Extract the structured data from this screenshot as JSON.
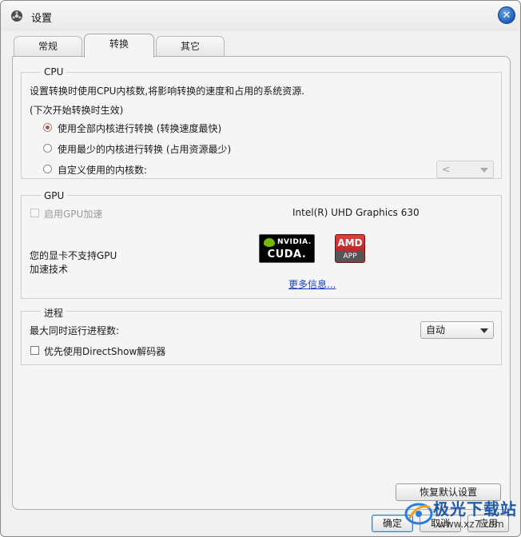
{
  "window": {
    "title": "设置"
  },
  "tabs": [
    {
      "label": "常规"
    },
    {
      "label": "转换"
    },
    {
      "label": "其它"
    }
  ],
  "cpu": {
    "group_label": "CPU",
    "description": "设置转换时使用CPU内核数,将影响转换的速度和占用的系统资源.",
    "note": "(下次开始转换时生效)",
    "options": [
      {
        "label": "使用全部内核进行转换 (转换速度最快)",
        "checked": true
      },
      {
        "label": "使用最少的内核进行转换 (占用资源最少)",
        "checked": false
      },
      {
        "label": "自定义使用的内核数:",
        "checked": false
      }
    ],
    "custom_select_value": "<"
  },
  "gpu": {
    "group_label": "GPU",
    "enable_label": "启用GPU加速",
    "adapter_name": "Intel(R) UHD Graphics 630",
    "unsupported_line1": "您的显卡不支持GPU",
    "unsupported_line2": "加速技术",
    "nvidia_brand": "NVIDIA.",
    "nvidia_product": "CUDA.",
    "amd_brand": "AMD",
    "amd_product": "APP",
    "more_info_link": "更多信息..."
  },
  "process": {
    "group_label": "进程",
    "max_processes_label": "最大同时运行进程数:",
    "max_processes_value": "自动",
    "directshow_label": "优先使用DirectShow解码器"
  },
  "buttons": {
    "restore_defaults": "恢复默认设置",
    "ok": "确定",
    "cancel": "取消",
    "apply": "应用"
  },
  "watermark": {
    "title": "极光下载站",
    "url": "www.xz7.com"
  },
  "colors": {
    "radio_selected": "#c2502e",
    "link": "#1a3fbf",
    "close_button": "#1e5bb8"
  }
}
